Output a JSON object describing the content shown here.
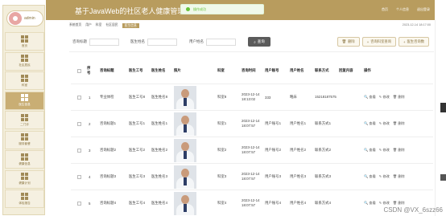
{
  "app": {
    "title": "基于JavaWeb的社区老人健康管理系统"
  },
  "user": {
    "name": "admin"
  },
  "header": {
    "links": [
      "首页",
      "个人信息",
      "退出登录"
    ]
  },
  "toast": {
    "message": "操作成功"
  },
  "colors": {
    "primary": "#b89c5e",
    "sidebar_bg": "#f3eedb",
    "success": "#67c23a"
  },
  "sidebar": {
    "items": [
      {
        "label": "首页",
        "icon": "home-icon"
      },
      {
        "label": "社区居民",
        "icon": "residents-icon"
      },
      {
        "label": "科室",
        "icon": "department-icon"
      },
      {
        "label": "医生信息",
        "icon": "doctor-icon",
        "active": true
      },
      {
        "label": "二门诊",
        "icon": "clinic-icon"
      },
      {
        "label": "服务套餐",
        "icon": "package-icon"
      },
      {
        "label": "健康信息",
        "icon": "health-icon"
      },
      {
        "label": "健康计划",
        "icon": "plan-icon"
      },
      {
        "label": "体检报告",
        "icon": "report-icon"
      }
    ]
  },
  "breadcrumb": {
    "items": [
      "系统首页",
      "用户",
      "科室",
      "社区居民"
    ],
    "active_tag": "医生信息",
    "time": "2023-12-14 18:17:00"
  },
  "search": {
    "fields": [
      {
        "label": "咨询标题"
      },
      {
        "label": "医生姓名"
      },
      {
        "label": "用户姓名"
      }
    ],
    "button": "查询"
  },
  "actions": {
    "delete": "删除",
    "stats": "咨询科室查询",
    "count": "医生咨询数"
  },
  "table": {
    "headers": [
      "序号",
      "咨询标题",
      "医生工号",
      "医生姓名",
      "照片",
      "科室",
      "咨询时间",
      "用户账号",
      "用户姓名",
      "联系方式",
      "回复内容",
      "操作"
    ],
    "rows": [
      {
        "no": "1",
        "title": "专业体检",
        "doc_id": "医生工号8",
        "doc_name": "医生姓名8",
        "dept": "科室8",
        "time": "2023-12-14 18:13:02",
        "account": "333",
        "user": "略床",
        "phone": "15218187575",
        "reply": ""
      },
      {
        "no": "2",
        "title": "咨询标题1",
        "doc_id": "医生工号1",
        "doc_name": "医生姓名1",
        "dept": "科室1",
        "time": "2023-12-14 18:07:57",
        "account": "用户账号1",
        "user": "用户姓名1",
        "phone": "联系方式1",
        "reply": ""
      },
      {
        "no": "3",
        "title": "咨询标题2",
        "doc_id": "医生工号2",
        "doc_name": "医生姓名2",
        "dept": "科室2",
        "time": "2023-12-14 18:07:57",
        "account": "用户账号2",
        "user": "用户姓名2",
        "phone": "联系方式2",
        "reply": ""
      },
      {
        "no": "4",
        "title": "咨询标题3",
        "doc_id": "医生工号3",
        "doc_name": "医生姓名3",
        "dept": "科室3",
        "time": "2023-12-14 18:07:57",
        "account": "用户账号3",
        "user": "用户姓名3",
        "phone": "联系方式3",
        "reply": ""
      },
      {
        "no": "5",
        "title": "咨询标题4",
        "doc_id": "医生工号4",
        "doc_name": "医生姓名4",
        "dept": "科室4",
        "time": "2023-12-14 18:07:57",
        "account": "用户账号4",
        "user": "用户姓名4",
        "phone": "联系方式4",
        "reply": ""
      }
    ],
    "ops": [
      "查看",
      "修改",
      "删除"
    ]
  },
  "watermark": "CSDN @VX_6szz66"
}
